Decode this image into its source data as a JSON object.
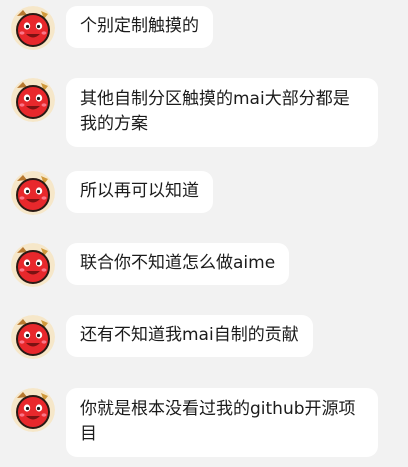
{
  "messages": [
    {
      "text": "个别定制触摸的"
    },
    {
      "text": "其他自制分区触摸的mai大部分都是我的方案"
    },
    {
      "text": "所以再可以知道"
    },
    {
      "text": "联合你不知道怎么做aime"
    },
    {
      "text": "还有不知道我mai自制的贡献"
    },
    {
      "text": "你就是根本没看过我的github开源项目"
    }
  ],
  "avatar": {
    "icon": "taiko-don-icon"
  },
  "colors": {
    "background": "#f2f2f2",
    "bubble": "#ffffff",
    "text": "#1b1b1b",
    "avatar_red": "#e8282c"
  }
}
